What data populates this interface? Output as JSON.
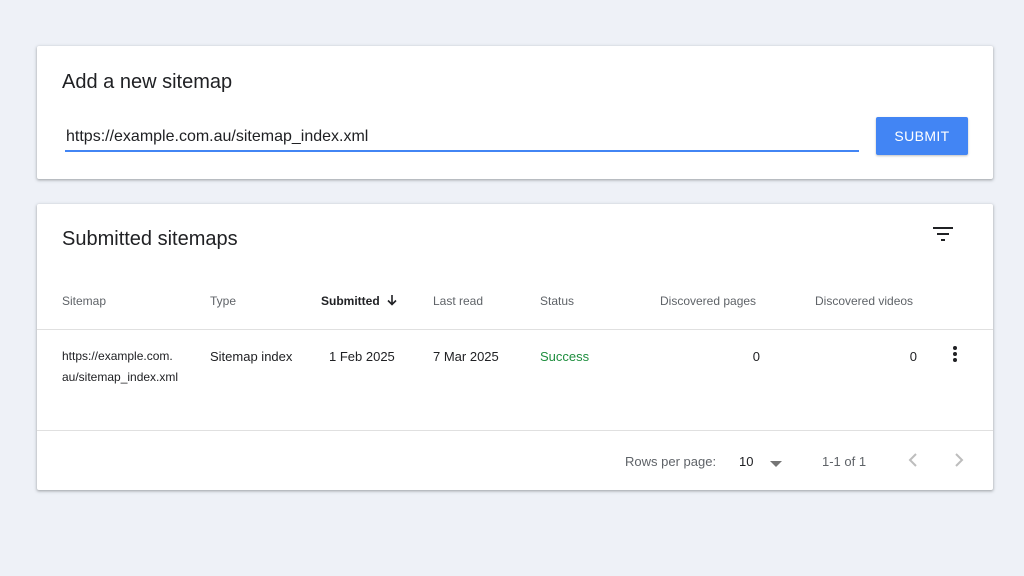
{
  "add_sitemap": {
    "title": "Add a new sitemap",
    "input_value": "https://example.com.au/sitemap_index.xml",
    "submit_label": "SUBMIT"
  },
  "submitted": {
    "title": "Submitted sitemaps",
    "filter_icon": "filter-icon",
    "columns": {
      "sitemap": "Sitemap",
      "type": "Type",
      "submitted": "Submitted",
      "last_read": "Last read",
      "status": "Status",
      "discovered_pages": "Discovered pages",
      "discovered_videos": "Discovered videos"
    },
    "sort_icon": "arrow-down-icon",
    "rows": [
      {
        "sitemap_line1": "https://example.com.",
        "sitemap_line2": "au/sitemap_index.xml",
        "type": "Sitemap index",
        "submitted": "1 Feb 2025",
        "last_read": "7 Mar 2025",
        "status": "Success",
        "discovered_pages": "0",
        "discovered_videos": "0"
      }
    ],
    "footer": {
      "rows_per_page_label": "Rows per page:",
      "rows_per_page_value": "10",
      "range": "1-1 of 1"
    }
  },
  "colors": {
    "accent": "#4285f4",
    "success": "#1e8e3e",
    "background": "#eef1f7"
  }
}
